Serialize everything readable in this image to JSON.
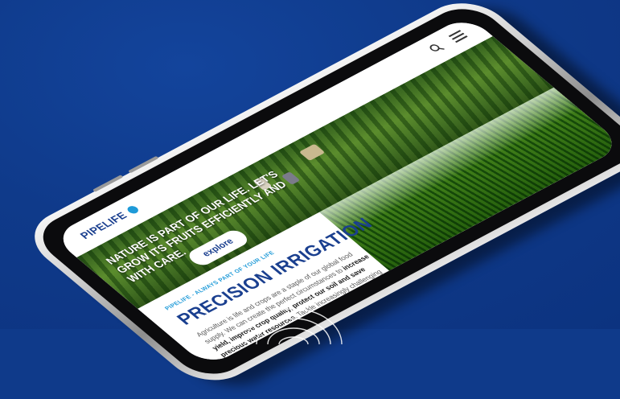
{
  "colors": {
    "background": "#0f3a8a",
    "brand_blue": "#1a3f8f",
    "accent_cyan": "#1e9ad8"
  },
  "header": {
    "logo_text": "PIPELIFE",
    "logo_icon": "pipelife-dot-icon",
    "search_icon": "search-icon",
    "menu_icon": "hamburger-menu-icon"
  },
  "hero": {
    "text": "NATURE IS PART OF OUR LIFE. LET'S GROW ITS FRUITS EFFICIENTLY AND WITH CARE.",
    "cta_label": "explore"
  },
  "section": {
    "tagline": "PIPELIFE - ALWAYS PART OF YOUR LIFE",
    "heading": "PRECISION IRRIGATION",
    "body_part1": "Agriculture is life and crops are a staple of our global food supply. We can create the perfect circumstances to ",
    "body_bold": "increase yield, improve crop quality, protect our soil and save precious water resources",
    "body_part2": ". Tackle increasingly challenging climate conditions with the help of our state-of-the-art precision irrigation."
  }
}
